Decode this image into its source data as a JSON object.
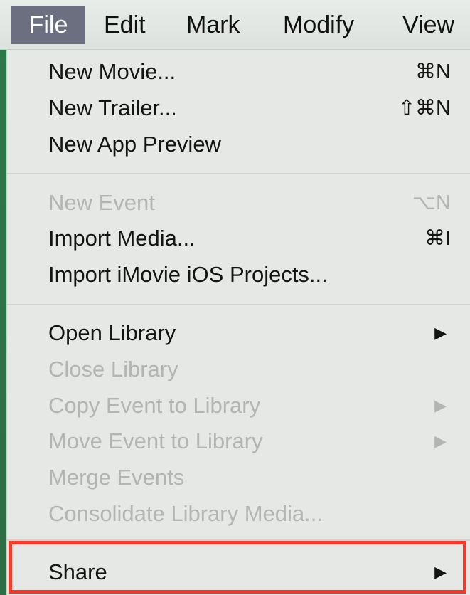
{
  "menubar": {
    "items": [
      {
        "label": "File"
      },
      {
        "label": "Edit"
      },
      {
        "label": "Mark"
      },
      {
        "label": "Modify"
      },
      {
        "label": "View"
      }
    ]
  },
  "file_menu": {
    "items": [
      {
        "label": "New Movie...",
        "shortcut": "⌘N",
        "enabled": true
      },
      {
        "label": "New Trailer...",
        "shortcut": "⇧⌘N",
        "enabled": true
      },
      {
        "label": "New App Preview",
        "shortcut": "",
        "enabled": true
      },
      {
        "label": "New Event",
        "shortcut": "⌥N",
        "enabled": false
      },
      {
        "label": "Import Media...",
        "shortcut": "⌘I",
        "enabled": true
      },
      {
        "label": "Import iMovie iOS Projects...",
        "shortcut": "",
        "enabled": true
      },
      {
        "label": "Open Library",
        "submenu_arrow": "▶",
        "enabled": true
      },
      {
        "label": "Close Library",
        "enabled": false
      },
      {
        "label": "Copy Event to Library",
        "submenu_arrow": "▶",
        "enabled": false
      },
      {
        "label": "Move Event to Library",
        "submenu_arrow": "▶",
        "enabled": false
      },
      {
        "label": "Merge Events",
        "enabled": false
      },
      {
        "label": "Consolidate Library Media...",
        "enabled": false
      },
      {
        "label": "Share",
        "submenu_arrow": "▶",
        "enabled": true,
        "highlighted": true
      }
    ]
  },
  "colors": {
    "active_menu_bg": "#6b6f7f",
    "highlight_border": "#f03a2c",
    "disabled_text": "#b3b5b4",
    "app_edge": "#2b7a4a"
  }
}
